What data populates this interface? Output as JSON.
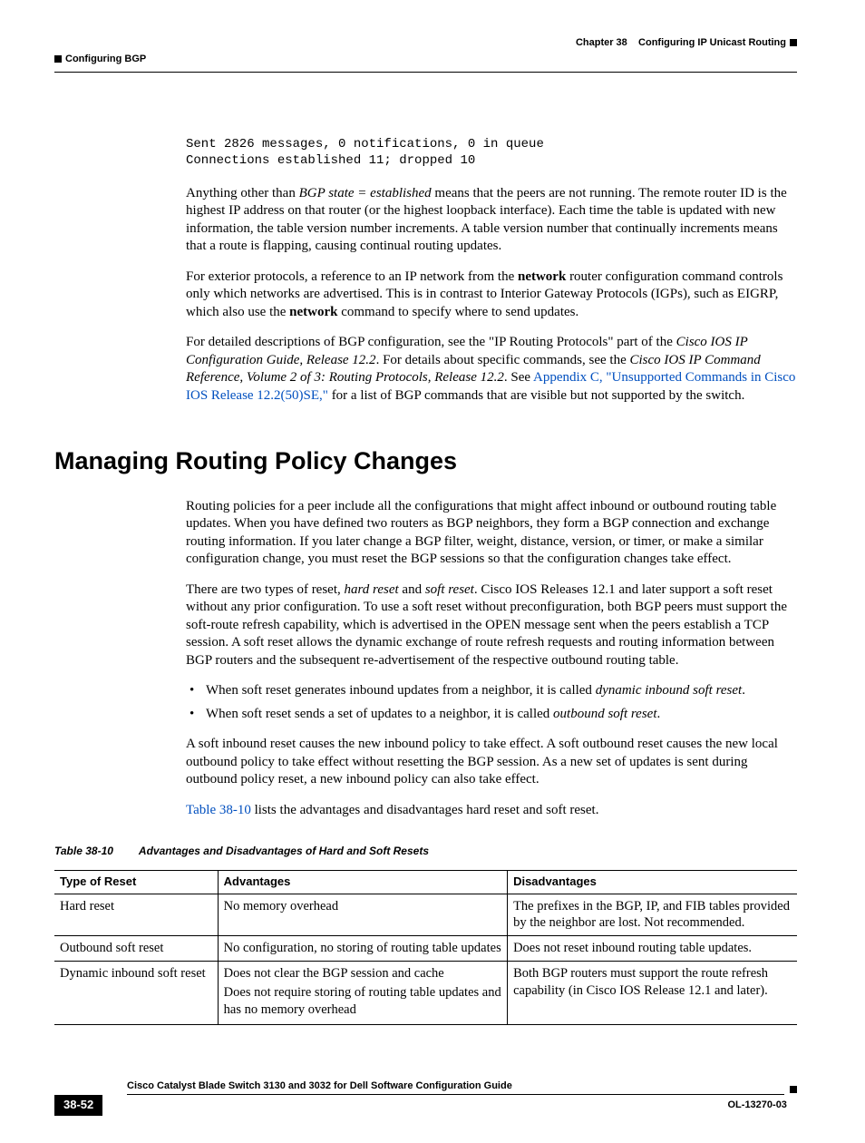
{
  "header": {
    "left": "Configuring BGP",
    "right_prefix": "Chapter 38",
    "right_title": "Configuring IP Unicast Routing"
  },
  "code": {
    "line1": "Sent 2826 messages, 0 notifications, 0 in queue",
    "line2": "Connections established 11; dropped 10"
  },
  "p1": {
    "pre": "Anything other than ",
    "em": "BGP state = established",
    "post": " means that the peers are not running. The remote router ID is the highest IP address on that router (or the highest loopback interface). Each time the table is updated with new information, the table version number increments. A table version number that continually increments means that a route is flapping, causing continual routing updates."
  },
  "p2": {
    "a": "For exterior protocols, a reference to an IP network from the ",
    "b1": "network",
    "b": " router configuration command controls only which networks are advertised. This is in contrast to Interior Gateway Protocols (IGPs), such as EIGRP, which also use the ",
    "b2": "network",
    "c": " command to specify where to send updates."
  },
  "p3": {
    "a": "For detailed descriptions of BGP configuration, see the \"IP Routing Protocols\" part of the ",
    "i1": "Cisco IOS IP Configuration Guide, Release 12.2",
    "b": ". For details about specific commands, see the ",
    "i2": "Cisco IOS IP Command Reference, Volume 2 of 3: Routing Protocols, Release 12.2",
    "c": ". See ",
    "link": "Appendix C, \"Unsupported Commands in Cisco IOS Release 12.2(50)SE,\"",
    "d": " for a list of BGP commands that are visible but not supported by the switch."
  },
  "h2": "Managing Routing Policy Changes",
  "p4": "Routing policies for a peer include all the configurations that might affect inbound or outbound routing table updates. When you have defined two routers as BGP neighbors, they form a BGP connection and exchange routing information. If you later change a BGP filter, weight, distance, version, or timer, or make a similar configuration change, you must reset the BGP sessions so that the configuration changes take effect.",
  "p5": {
    "a": "There are two types of reset, ",
    "i1": "hard reset",
    "b": " and ",
    "i2": "soft reset",
    "c": ". Cisco IOS Releases 12.1 and later support a soft reset without any prior configuration. To use a soft reset without preconfiguration, both BGP peers must support the soft-route refresh capability, which is advertised in the OPEN message sent when the peers establish a TCP session. A soft reset allows the dynamic exchange of route refresh requests and routing information between BGP routers and the subsequent re-advertisement of the respective outbound routing table."
  },
  "bullets": [
    {
      "pre": "When soft reset generates inbound updates from a neighbor, it is called ",
      "em": "dynamic inbound soft reset",
      "post": "."
    },
    {
      "pre": "When soft reset sends a set of updates to a neighbor, it is called ",
      "em": "outbound soft reset",
      "post": "."
    }
  ],
  "p6": "A soft inbound reset causes the new inbound policy to take effect. A soft outbound reset causes the new local outbound policy to take effect without resetting the BGP session. As a new set of updates is sent during outbound policy reset, a new inbound policy can also take effect.",
  "p7": {
    "link": "Table 38-10",
    "rest": " lists the advantages and disadvantages hard reset and soft reset."
  },
  "table": {
    "label": "Table 38-10",
    "title": "Advantages and Disadvantages of Hard and Soft Resets",
    "headers": [
      "Type of Reset",
      "Advantages",
      "Disadvantages"
    ],
    "rows": [
      {
        "c0": "Hard reset",
        "c1": "No memory overhead",
        "c2": "The prefixes in the BGP, IP, and FIB tables provided by the neighbor are lost. Not recommended."
      },
      {
        "c0": "Outbound soft reset",
        "c1": "No configuration, no storing of routing table updates",
        "c2": "Does not reset inbound routing table updates."
      },
      {
        "c0": "Dynamic inbound soft reset",
        "c1a": "Does not clear the BGP session and cache",
        "c1b": "Does not require storing of routing table updates and has no memory overhead",
        "c2": "Both BGP routers must support the route refresh capability (in Cisco IOS Release 12.1 and later)."
      }
    ]
  },
  "footer": {
    "book": "Cisco Catalyst Blade Switch 3130 and 3032 for Dell Software Configuration Guide",
    "page": "38-52",
    "doc": "OL-13270-03"
  }
}
